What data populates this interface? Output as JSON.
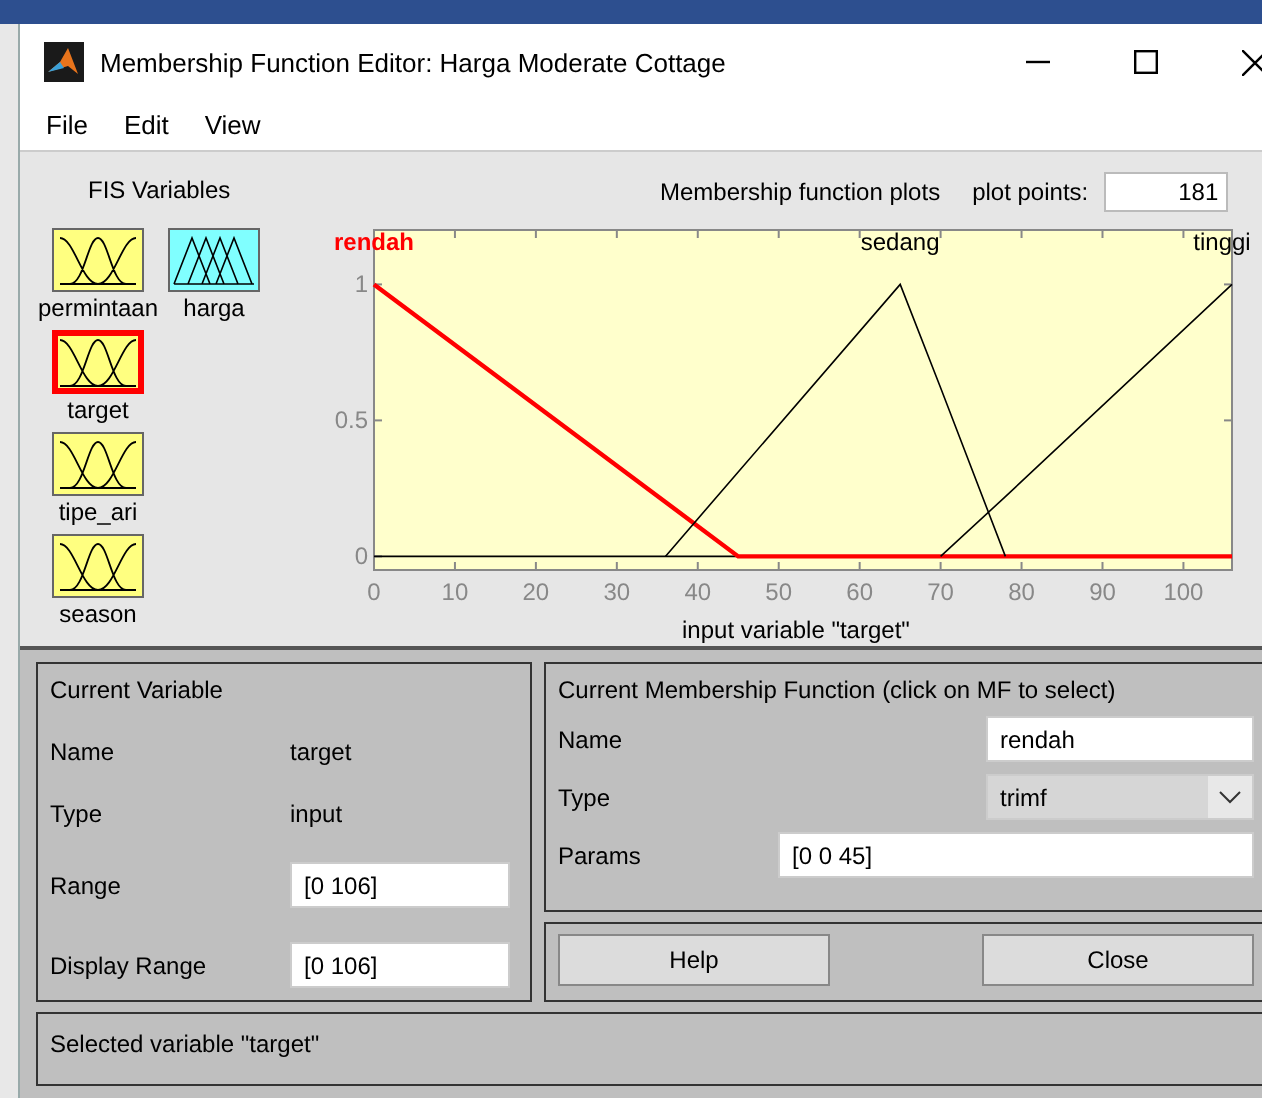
{
  "window": {
    "title": "Membership Function Editor: Harga Moderate Cottage"
  },
  "menu": [
    "File",
    "Edit",
    "View"
  ],
  "fis_variables": {
    "title": "FIS Variables",
    "items": [
      {
        "name": "permintaan",
        "kind": "input",
        "selected": false
      },
      {
        "name": "harga",
        "kind": "output",
        "selected": false
      },
      {
        "name": "target",
        "kind": "input",
        "selected": true
      },
      {
        "name": "tipe_ari",
        "kind": "input",
        "selected": false
      },
      {
        "name": "season",
        "kind": "input",
        "selected": false
      }
    ]
  },
  "plot": {
    "plot_points_label": "plot points:",
    "plot_points": "181",
    "chart_data": {
      "type": "line",
      "title": "Membership function plots",
      "xlabel": "input variable \"target\"",
      "x": [
        0,
        36,
        45,
        65,
        70,
        78,
        106
      ],
      "series": [
        {
          "name": "rendah",
          "color": "#ff0000",
          "values": [
            1,
            0.2,
            0,
            0,
            0,
            0,
            0
          ]
        },
        {
          "name": "sedang",
          "color": "#000000",
          "values": [
            null,
            0,
            0.31,
            1,
            0.62,
            0,
            null
          ]
        },
        {
          "name": "tinggi",
          "color": "#000000",
          "values": [
            null,
            null,
            null,
            null,
            0,
            0.22,
            1
          ]
        }
      ],
      "xlim": [
        0,
        106
      ],
      "ylim": [
        -0.05,
        1.2
      ],
      "xticks": [
        0,
        10,
        20,
        30,
        40,
        50,
        60,
        70,
        80,
        90,
        100
      ],
      "yticks": [
        0,
        0.5,
        1
      ]
    }
  },
  "current_variable": {
    "title": "Current Variable",
    "name_label": "Name",
    "name": "target",
    "type_label": "Type",
    "type": "input",
    "range_label": "Range",
    "range": "[0 106]",
    "display_range_label": "Display Range",
    "display_range": "[0 106]"
  },
  "current_mf": {
    "title": "Current Membership Function (click on MF to select)",
    "name_label": "Name",
    "name": "rendah",
    "type_label": "Type",
    "type": "trimf",
    "params_label": "Params",
    "params": "[0 0 45]"
  },
  "buttons": [
    "Help",
    "Close"
  ],
  "status_bar": "Selected variable \"target\""
}
